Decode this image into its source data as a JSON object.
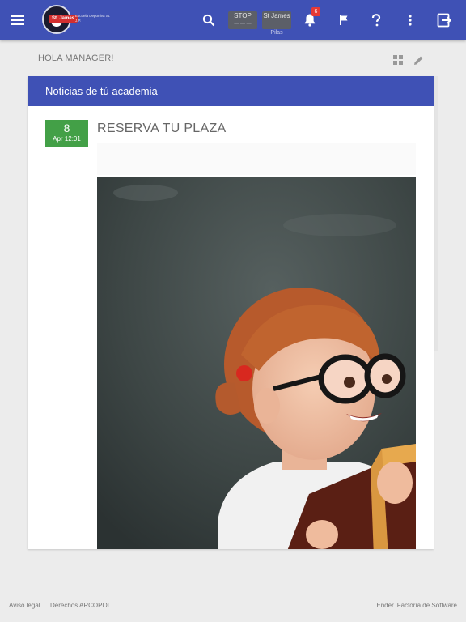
{
  "topbar": {
    "logo_ribbon_text": "St. James",
    "logo_text": "Escuela Deportiva St. J.P.",
    "chip_stop": {
      "label": "STOP",
      "sub": "— — —"
    },
    "chip_academy": {
      "label": "St James",
      "caption": "Pilas"
    },
    "notifications_count": "6",
    "colors": {
      "bar": "#3f51b5",
      "badge": "#e53935"
    }
  },
  "greeting": "HOLA MANAGER!",
  "news": {
    "header": "Noticias de tú academia",
    "posts": [
      {
        "day": "8",
        "when": "Apr 12:01",
        "title": "RESERVA TU PLAZA",
        "date_color": "#43a047"
      }
    ]
  },
  "footer": {
    "legal": "Aviso legal",
    "arco": "Derechos ARCOPOL",
    "credit": "Ender. Factoría de Software"
  }
}
